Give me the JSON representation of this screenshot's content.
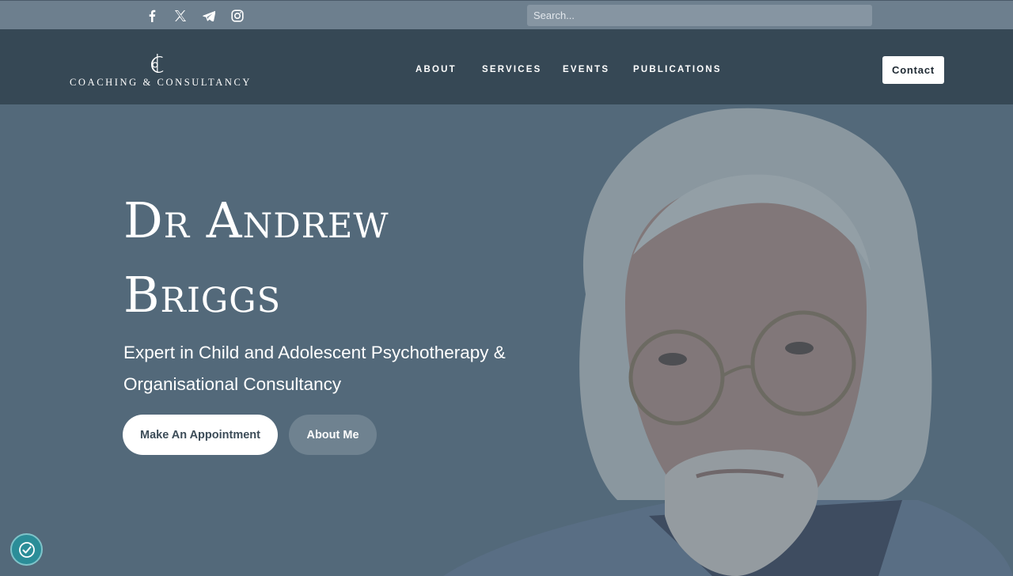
{
  "topbar": {
    "social": [
      {
        "name": "facebook-icon"
      },
      {
        "name": "x-twitter-icon"
      },
      {
        "name": "telegram-icon"
      },
      {
        "name": "instagram-icon"
      }
    ],
    "search_placeholder": "Search..."
  },
  "header": {
    "logo_text": "COACHING & CONSULTANCY",
    "nav": [
      "ABOUT",
      "SERVICES",
      "EVENTS",
      "PUBLICATIONS"
    ],
    "contact_label": "Contact"
  },
  "hero": {
    "title_line1": "Dr Andrew",
    "title_line2": "Briggs",
    "subtitle_line1": "Expert in Child and Adolescent Psychotherapy &",
    "subtitle_line2": "Organisational Consultancy",
    "primary_button": "Make An Appointment",
    "secondary_button": "About Me"
  },
  "colors": {
    "topbar": "#6d7f8e",
    "header": "#364855",
    "hero_overlay": "#53697a",
    "cookie_button": "#2b8d98"
  }
}
